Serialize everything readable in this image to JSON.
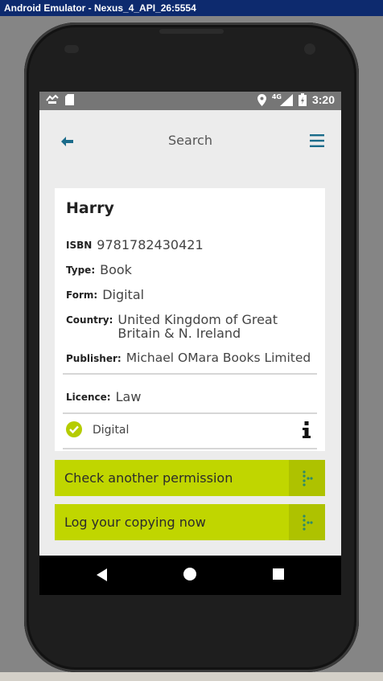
{
  "window": {
    "title": "Android Emulator - Nexus_4_API_26:5554"
  },
  "status_bar": {
    "time": "3:20",
    "network": "4G"
  },
  "toolbar": {
    "title": "Search"
  },
  "book": {
    "title": "Harry",
    "isbn_label": "ISBN",
    "isbn": "9781782430421",
    "type_label": "Type:",
    "type": "Book",
    "form_label": "Form:",
    "form": "Digital",
    "country_label": "Country:",
    "country": "United Kingdom of Great Britain & N. Ireland",
    "publisher_label": "Publisher:",
    "publisher": "Michael OMara Books Limited",
    "licence_label": "Licence:",
    "licence": "Law",
    "permission_status": "Digital"
  },
  "actions": {
    "check_another": "Check another permission",
    "log_copying": "Log your copying now"
  },
  "colors": {
    "accent": "#c0d600",
    "accent_dark": "#aec200",
    "toolbar_icon": "#1a6b8a",
    "check_green": "#b5cc00"
  }
}
